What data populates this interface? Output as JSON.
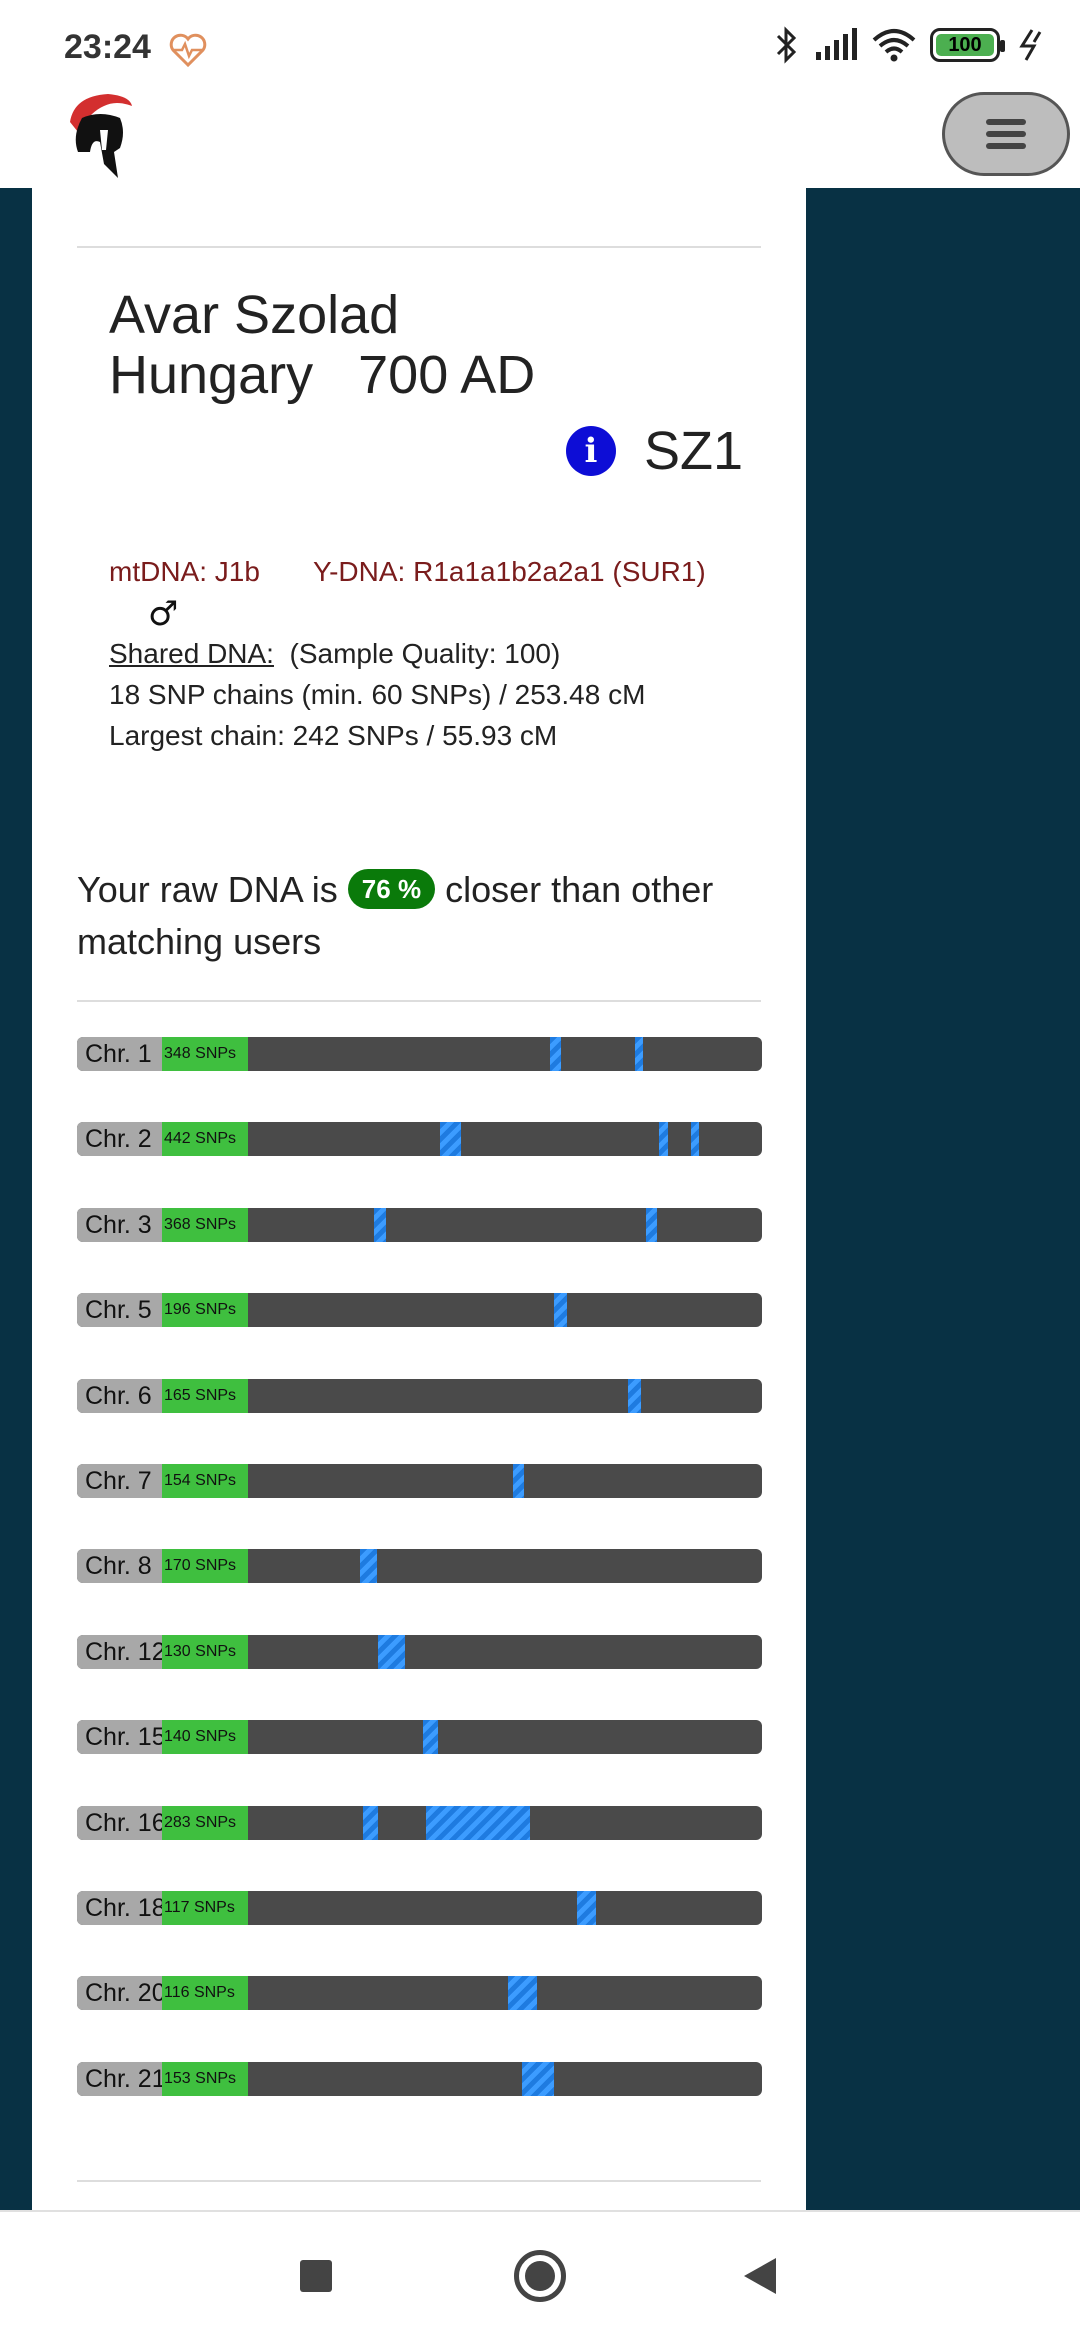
{
  "status_bar": {
    "time": "23:24",
    "battery": "100",
    "icons": [
      "heart-rate-icon",
      "bluetooth-icon",
      "signal-icon",
      "wifi-icon",
      "battery-icon",
      "charging-icon"
    ]
  },
  "header": {
    "logo": "spartan-helmet-logo",
    "menu_icon": "hamburger-menu-icon"
  },
  "sample": {
    "name": "Avar Szolad",
    "location": "Hungary",
    "date": "700 AD",
    "code": "SZ1",
    "mtdna": "mtDNA: J1b",
    "ydna": "Y-DNA: R1a1a1b2a2a1 (SUR1)",
    "sex_symbol": "♂",
    "shared_dna_label": "Shared DNA:",
    "sample_quality": "(Sample Quality: 100)",
    "snp_chains": "18 SNP chains (min. 60 SNPs) / 253.48 cM",
    "largest_chain": "Largest chain: 242 SNPs / 55.93 cM"
  },
  "comparison": {
    "prefix": "Your raw DNA is",
    "percent": "76 %",
    "suffix": "closer than other matching users"
  },
  "chromosomes": [
    {
      "label": "Chr. 1",
      "snps": "348 SNPs",
      "segments": [
        [
          0.69,
          0.016
        ],
        [
          0.814,
          0.012
        ]
      ]
    },
    {
      "label": "Chr. 2",
      "snps": "442 SNPs",
      "segments": [
        [
          0.53,
          0.031
        ],
        [
          0.85,
          0.013
        ],
        [
          0.896,
          0.012
        ]
      ]
    },
    {
      "label": "Chr. 3",
      "snps": "368 SNPs",
      "segments": [
        [
          0.434,
          0.017
        ],
        [
          0.83,
          0.017
        ]
      ]
    },
    {
      "label": "Chr. 5",
      "snps": "196 SNPs",
      "segments": [
        [
          0.697,
          0.018
        ]
      ]
    },
    {
      "label": "Chr. 6",
      "snps": "165 SNPs",
      "segments": [
        [
          0.804,
          0.019
        ]
      ]
    },
    {
      "label": "Chr. 7",
      "snps": "154 SNPs",
      "segments": [
        [
          0.637,
          0.016
        ]
      ]
    },
    {
      "label": "Chr. 8",
      "snps": "170 SNPs",
      "segments": [
        [
          0.413,
          0.025
        ]
      ]
    },
    {
      "label": "Chr. 12",
      "snps": "130 SNPs",
      "segments": [
        [
          0.44,
          0.039
        ]
      ]
    },
    {
      "label": "Chr. 15",
      "snps": "140 SNPs",
      "segments": [
        [
          0.505,
          0.022
        ]
      ]
    },
    {
      "label": "Chr. 16",
      "snps": "283 SNPs",
      "segments": [
        [
          0.417,
          0.022
        ],
        [
          0.509,
          0.153
        ]
      ]
    },
    {
      "label": "Chr. 18",
      "snps": "117 SNPs",
      "segments": [
        [
          0.73,
          0.027
        ]
      ]
    },
    {
      "label": "Chr. 20",
      "snps": "116 SNPs",
      "segments": [
        [
          0.629,
          0.042
        ]
      ]
    },
    {
      "label": "Chr. 21",
      "snps": "153 SNPs",
      "segments": [
        [
          0.65,
          0.046
        ]
      ]
    }
  ],
  "nav": {
    "recents_icon": "recents-square-icon",
    "home_icon": "home-circle-icon",
    "back_icon": "back-triangle-icon"
  }
}
